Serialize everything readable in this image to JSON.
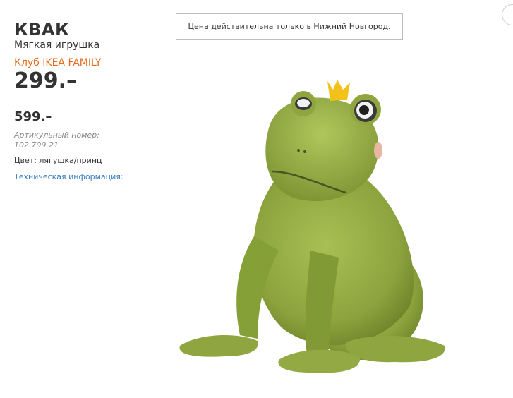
{
  "product": {
    "name": "КВАК",
    "type": "Мягкая игрушка",
    "family_label": "Клуб IKEA FAMILY",
    "family_price": "299.–",
    "regular_price": "599.–",
    "article_label": "Артикульный номер: 102.799.21",
    "color_label": "Цвет: лягушка/принц",
    "tech_info_link": "Техническая информация:"
  },
  "notice": "Цена действительна только в Нижний Новгород.",
  "colors": {
    "family_orange": "#e56a1a",
    "link_blue": "#3a7ec1",
    "frog_green": "#8fa640",
    "crown_yellow": "#f2c21a"
  }
}
